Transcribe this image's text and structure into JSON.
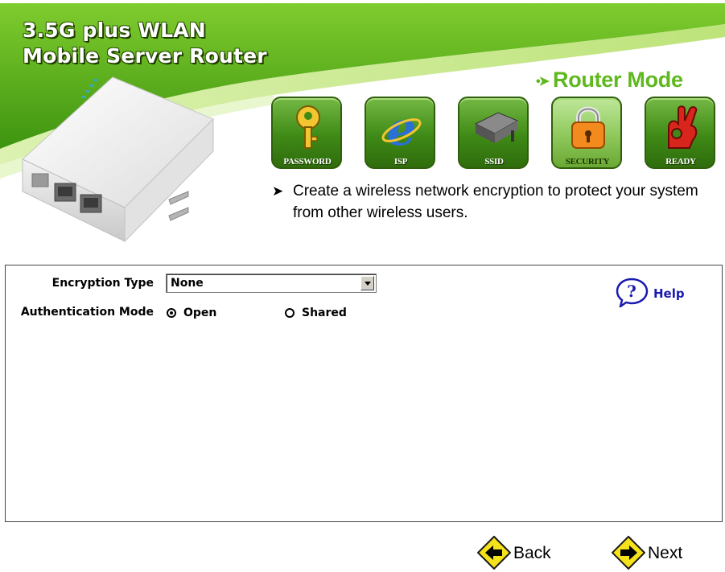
{
  "header": {
    "title_line1": "3.5G plus WLAN",
    "title_line2": "Mobile Server Router",
    "mode": "Router Mode",
    "mode_icon": "double-arrow-bullet"
  },
  "steps": [
    {
      "label": "PASSWORD",
      "icon": "key-icon",
      "active": false
    },
    {
      "label": "ISP",
      "icon": "internet-explorer-icon",
      "active": false
    },
    {
      "label": "SSID",
      "icon": "access-point-device-icon",
      "active": false
    },
    {
      "label": "SECURITY",
      "icon": "padlock-icon",
      "active": true
    },
    {
      "label": "READY",
      "icon": "ok-hand-icon",
      "active": false
    }
  ],
  "description": {
    "bullet": "➤",
    "text": "Create a wireless network encryption to protect your system from other wireless users."
  },
  "form": {
    "encryption_type_label": "Encryption Type",
    "encryption_type_value": "None",
    "authentication_mode_label": "Authentication Mode",
    "auth_options": [
      {
        "label": "Open",
        "checked": true
      },
      {
        "label": "Shared",
        "checked": false
      }
    ]
  },
  "help": {
    "label": "Help"
  },
  "buttons": {
    "back": "Back",
    "next": "Next"
  },
  "colors": {
    "accent_green": "#5fb81e",
    "header_green": "#8cc63f",
    "help_blue": "#1a1ab0",
    "nav_yellow": "#f5e21a"
  }
}
